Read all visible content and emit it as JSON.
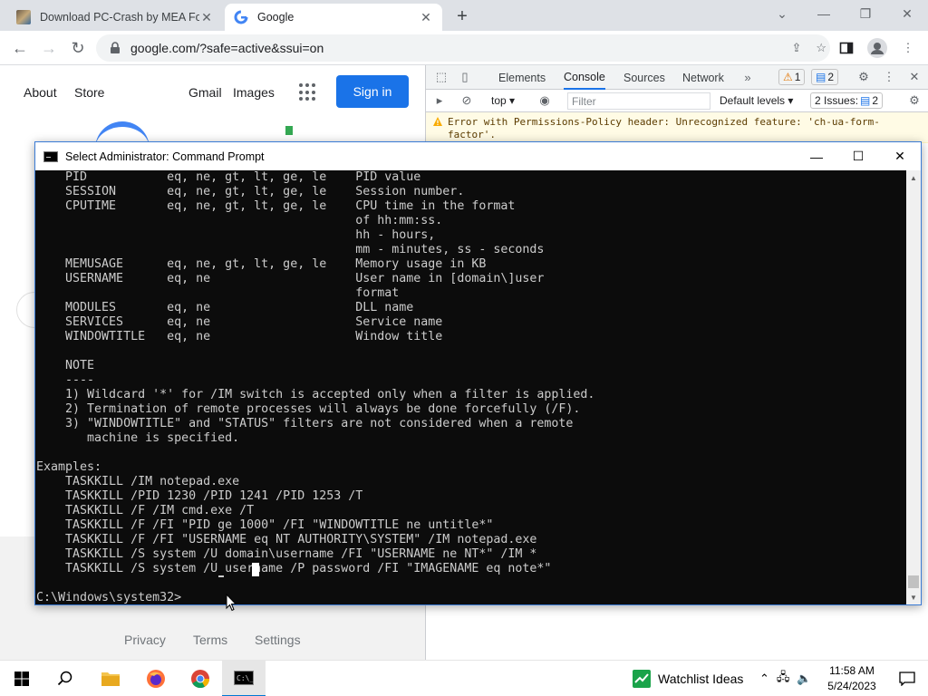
{
  "browser": {
    "tabs": [
      {
        "title": "Download PC-Crash by MEA Forensic",
        "active": false
      },
      {
        "title": "Google",
        "active": true
      }
    ],
    "url": "google.com/?safe=active&ssui=on"
  },
  "google": {
    "nav_about": "About",
    "nav_store": "Store",
    "nav_gmail": "Gmail",
    "nav_images": "Images",
    "signin_label": "Sign in",
    "footer": {
      "privacy": "Privacy",
      "terms": "Terms",
      "settings": "Settings"
    }
  },
  "devtools": {
    "tabs": [
      "Elements",
      "Console",
      "Sources",
      "Network"
    ],
    "active_tab": "Console",
    "warning_count": "1",
    "message_count": "2",
    "context": "top",
    "filter_placeholder": "Filter",
    "levels": "Default levels",
    "issues_label": "2 Issues:",
    "issues_count": "2",
    "error_text": "Error with Permissions-Policy header: Unrecognized feature: 'ch-ua-form-factor'."
  },
  "cmd": {
    "title": "Select Administrator:  Command Prompt",
    "lines": [
      "    PID           eq, ne, gt, lt, ge, le    PID value",
      "    SESSION       eq, ne, gt, lt, ge, le    Session number.",
      "    CPUTIME       eq, ne, gt, lt, ge, le    CPU time in the format",
      "                                            of hh:mm:ss.",
      "                                            hh - hours,",
      "                                            mm - minutes, ss - seconds",
      "    MEMUSAGE      eq, ne, gt, lt, ge, le    Memory usage in KB",
      "    USERNAME      eq, ne                    User name in [domain\\]user",
      "                                            format",
      "    MODULES       eq, ne                    DLL name",
      "    SERVICES      eq, ne                    Service name",
      "    WINDOWTITLE   eq, ne                    Window title",
      "",
      "    NOTE",
      "    ----",
      "    1) Wildcard '*' for /IM switch is accepted only when a filter is applied.",
      "    2) Termination of remote processes will always be done forcefully (/F).",
      "    3) \"WINDOWTITLE\" and \"STATUS\" filters are not considered when a remote",
      "       machine is specified.",
      "",
      "Examples:",
      "    TASKKILL /IM notepad.exe",
      "    TASKKILL /PID 1230 /PID 1241 /PID 1253 /T",
      "    TASKKILL /F /IM cmd.exe /T",
      "    TASKKILL /F /FI \"PID ge 1000\" /FI \"WINDOWTITLE ne untitle*\"",
      "    TASKKILL /F /FI \"USERNAME eq NT AUTHORITY\\SYSTEM\" /IM notepad.exe",
      "    TASKKILL /S system /U domain\\username /FI \"USERNAME ne NT*\" /IM *",
      "    TASKKILL /S system /U username /P password /FI \"IMAGENAME eq note*\"",
      "",
      "C:\\Windows\\system32>"
    ]
  },
  "taskbar": {
    "watchlist": "Watchlist Ideas",
    "time": "11:58 AM",
    "date": "5/24/2023"
  },
  "colors": {
    "signin_blue": "#1a73e8",
    "console_bg": "#0c0c0c",
    "console_text": "#cccccc"
  }
}
